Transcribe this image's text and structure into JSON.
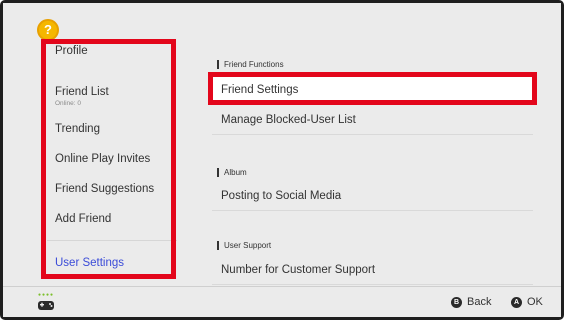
{
  "sidebar": {
    "items": [
      {
        "label": "Profile"
      },
      {
        "label": "Friend List",
        "sub": "Online: 0"
      },
      {
        "label": "Trending"
      },
      {
        "label": "Online Play Invites"
      },
      {
        "label": "Friend Suggestions"
      },
      {
        "label": "Add Friend"
      },
      {
        "label": "User Settings",
        "active": true
      }
    ]
  },
  "main": {
    "sections": [
      {
        "label": "Friend Functions",
        "rows": [
          "Friend Settings",
          "Manage Blocked-User List"
        ]
      },
      {
        "label": "Album",
        "rows": [
          "Posting to Social Media"
        ]
      },
      {
        "label": "User Support",
        "rows": [
          "Number for Customer Support"
        ]
      }
    ],
    "selected_row": "Friend Settings"
  },
  "footer": {
    "back": {
      "button": "B",
      "label": "Back"
    },
    "ok": {
      "button": "A",
      "label": "OK"
    }
  },
  "avatar": {
    "glyph": "?"
  },
  "colors": {
    "highlight": "#e3061b",
    "active": "#3a4bd8",
    "background": "#ebebeb"
  }
}
